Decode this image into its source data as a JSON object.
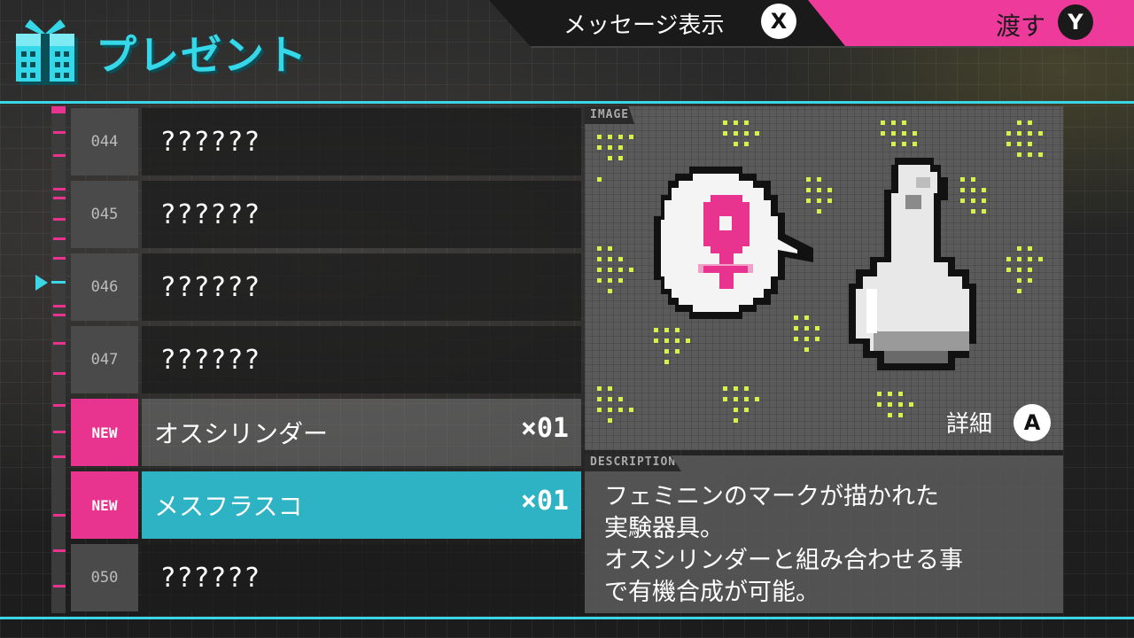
{
  "header": {
    "title": "プレゼント",
    "message_label": "メッセージ表示",
    "message_button": "X",
    "give_label": "渡す",
    "give_button": "Y"
  },
  "list": {
    "rows": [
      {
        "number": "044",
        "name": "??????",
        "quantity": "",
        "is_new": false
      },
      {
        "number": "045",
        "name": "??????",
        "quantity": "",
        "is_new": false
      },
      {
        "number": "046",
        "name": "??????",
        "quantity": "",
        "is_new": false
      },
      {
        "number": "047",
        "name": "??????",
        "quantity": "",
        "is_new": false
      },
      {
        "number": "NEW",
        "name": "オスシリンダー",
        "quantity": "×01",
        "is_new": true
      },
      {
        "number": "NEW",
        "name": "メスフラスコ",
        "quantity": "×01",
        "is_new": true,
        "selected": true
      },
      {
        "number": "050",
        "name": "??????",
        "quantity": "",
        "is_new": false
      }
    ]
  },
  "image_panel": {
    "tag": "IMAGE",
    "detail_label": "詳細",
    "detail_button": "A",
    "icon": "female-symbol-flask-icon"
  },
  "description": {
    "tag": "DESCRIPTION",
    "lines": [
      "フェミニンのマークが描かれた",
      "実験器具。",
      "オスシリンダーと組み合わせる事",
      "で有機合成が可能。"
    ]
  },
  "colors": {
    "accent_cyan": "#3bd6e6",
    "accent_pink": "#e8348e",
    "selected_row": "#2db3c3"
  }
}
